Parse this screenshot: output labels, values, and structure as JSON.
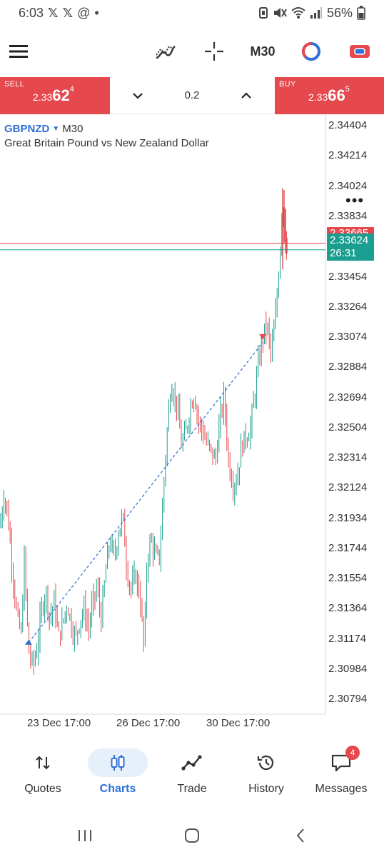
{
  "status": {
    "time": "6:03",
    "notif_icons": [
      "x-logo-icon",
      "x-logo-icon",
      "at-icon"
    ],
    "dot": "•",
    "battery": "56%"
  },
  "toolbar": {
    "timeframe": "M30"
  },
  "trade": {
    "sell": {
      "label": "SELL",
      "price_prefix": "2.33",
      "price_big": "62",
      "price_sup": "4"
    },
    "buy": {
      "label": "BUY",
      "price_prefix": "2.33",
      "price_big": "66",
      "price_sup": "5"
    },
    "volume": "0.2"
  },
  "chart": {
    "symbol": "GBPNZD",
    "timeframe": "M30",
    "description": "Great Britain Pound vs New Zealand Dollar",
    "ask_price": "2.33665",
    "bid_price": "2.33624",
    "countdown": "26:31"
  },
  "chart_data": {
    "type": "candlestick",
    "symbol": "GBPNZD",
    "timeframe": "M30",
    "ylim": [
      2.307,
      2.3445
    ],
    "y_ticks": [
      "2.34404",
      "2.34214",
      "2.34024",
      "2.33834",
      "2.33644",
      "2.33454",
      "2.33264",
      "2.33074",
      "2.32884",
      "2.32694",
      "2.32504",
      "2.32314",
      "2.32124",
      "2.31934",
      "2.31744",
      "2.31554",
      "2.31364",
      "2.31174",
      "2.30984",
      "2.30794"
    ],
    "x_ticks": [
      "23 Dec 17:00",
      "26 Dec 17:00",
      "30 Dec 17:00"
    ],
    "bid_line": 2.33624,
    "ask_line": 2.33665,
    "colors": {
      "bull": "#1a9e8f",
      "bear": "#e5484d",
      "bid": "#1a9e8f",
      "ask": "#e5484d",
      "trend": "#2f6fd6"
    },
    "path": [
      [
        0,
        2.3188
      ],
      [
        6,
        2.321
      ],
      [
        12,
        2.319
      ],
      [
        18,
        2.3158
      ],
      [
        24,
        2.313
      ],
      [
        30,
        2.312
      ],
      [
        34,
        2.3168
      ],
      [
        40,
        2.311
      ],
      [
        46,
        2.31
      ],
      [
        52,
        2.3112
      ],
      [
        58,
        2.3135
      ],
      [
        64,
        2.3148
      ],
      [
        70,
        2.313
      ],
      [
        76,
        2.3142
      ],
      [
        82,
        2.3118
      ],
      [
        88,
        2.3128
      ],
      [
        94,
        2.314
      ],
      [
        100,
        2.3126
      ],
      [
        106,
        2.3118
      ],
      [
        112,
        2.313
      ],
      [
        118,
        2.3136
      ],
      [
        124,
        2.3124
      ],
      [
        130,
        2.314
      ],
      [
        136,
        2.315
      ],
      [
        142,
        2.313
      ],
      [
        148,
        2.316
      ],
      [
        154,
        2.318
      ],
      [
        160,
        2.3168
      ],
      [
        166,
        2.3185
      ],
      [
        172,
        2.3195
      ],
      [
        178,
        2.316
      ],
      [
        184,
        2.3148
      ],
      [
        190,
        2.3158
      ],
      [
        196,
        2.3145
      ],
      [
        202,
        2.311
      ],
      [
        206,
        2.3168
      ],
      [
        212,
        2.318
      ],
      [
        218,
        2.3168
      ],
      [
        224,
        2.317
      ],
      [
        230,
        2.322
      ],
      [
        236,
        2.326
      ],
      [
        240,
        2.328
      ],
      [
        244,
        2.327
      ],
      [
        248,
        2.3265
      ],
      [
        254,
        2.324
      ],
      [
        260,
        2.3246
      ],
      [
        266,
        2.3262
      ],
      [
        272,
        2.3272
      ],
      [
        278,
        2.3255
      ],
      [
        284,
        2.3248
      ],
      [
        290,
        2.324
      ],
      [
        296,
        2.3235
      ],
      [
        302,
        2.323
      ],
      [
        308,
        2.3255
      ],
      [
        314,
        2.327
      ],
      [
        320,
        2.323
      ],
      [
        326,
        2.3215
      ],
      [
        332,
        2.3218
      ],
      [
        338,
        2.3238
      ],
      [
        344,
        2.3245
      ],
      [
        350,
        2.3248
      ],
      [
        356,
        2.3268
      ],
      [
        362,
        2.329
      ],
      [
        368,
        2.3308
      ],
      [
        374,
        2.3315
      ],
      [
        380,
        2.3296
      ],
      [
        386,
        2.332
      ],
      [
        392,
        2.336
      ],
      [
        396,
        2.3398
      ],
      [
        400,
        2.3366
      ],
      [
        402,
        2.33624
      ]
    ],
    "trend_line": {
      "from": [
        40,
        2.3115
      ],
      "to": [
        368,
        2.3304
      ]
    },
    "markers": [
      {
        "type": "buy-arrow",
        "x": 40,
        "y": 2.3116
      },
      {
        "type": "sell-arrow",
        "x": 368,
        "y": 2.3307
      }
    ]
  },
  "nav": {
    "items": [
      {
        "key": "quotes",
        "label": "Quotes"
      },
      {
        "key": "charts",
        "label": "Charts"
      },
      {
        "key": "trade",
        "label": "Trade"
      },
      {
        "key": "history",
        "label": "History"
      },
      {
        "key": "messages",
        "label": "Messages"
      }
    ],
    "active": "charts",
    "messages_badge": "4"
  }
}
